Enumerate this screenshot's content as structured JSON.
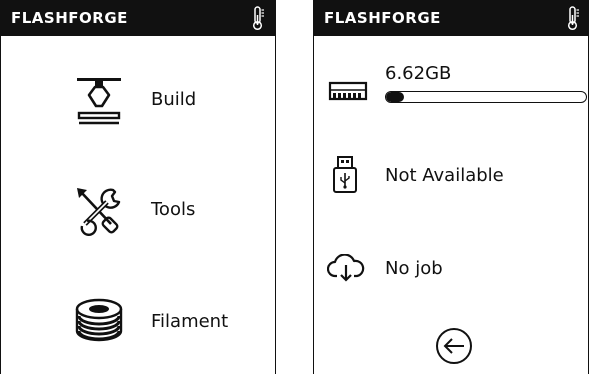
{
  "left_screen": {
    "brand": "FLASHFORGE",
    "menu": [
      {
        "label": "Build",
        "icon": "build-icon"
      },
      {
        "label": "Tools",
        "icon": "tools-icon"
      },
      {
        "label": "Filament",
        "icon": "filament-icon"
      }
    ]
  },
  "right_screen": {
    "brand": "FLASHFORGE",
    "storage": {
      "value": "6.62GB",
      "icon": "storage-icon",
      "progress_fraction": 0.09
    },
    "usb": {
      "status": "Not Available",
      "icon": "usb-icon"
    },
    "cloud": {
      "status": "No job",
      "icon": "cloud-download-icon"
    },
    "back_icon": "back-arrow-icon"
  },
  "colors": {
    "header_bg": "#111111",
    "header_text": "#ffffff",
    "foreground": "#111111",
    "background": "#ffffff"
  }
}
